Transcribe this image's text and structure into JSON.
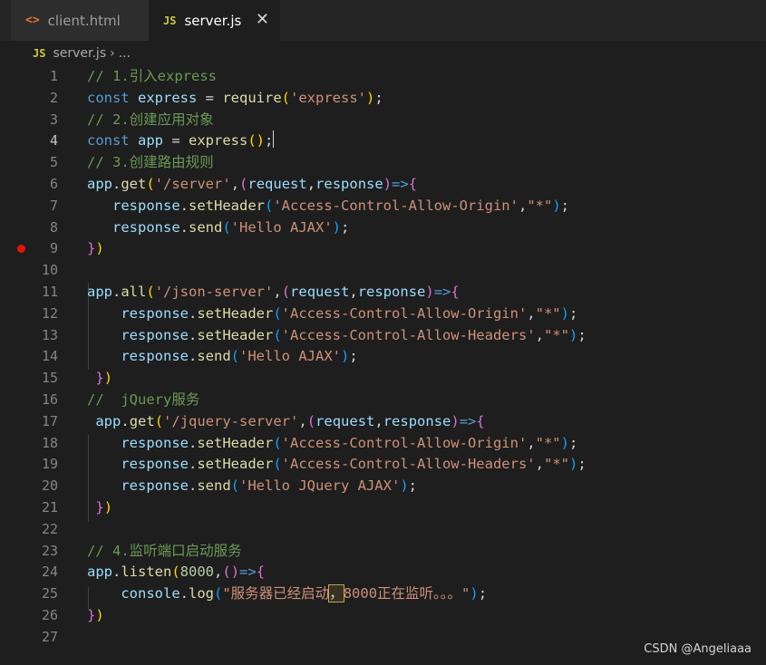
{
  "tabs": [
    {
      "icon": "<>",
      "label": "client.html"
    },
    {
      "icon": "JS",
      "label": "server.js",
      "close": "✕"
    }
  ],
  "breadcrumb": {
    "icon": "JS",
    "file": "server.js",
    "sep": "›",
    "rest": "..."
  },
  "lines": [
    {
      "n": "1",
      "t": [
        [
          "c",
          "// 1.引入express"
        ]
      ]
    },
    {
      "n": "2",
      "t": [
        [
          "k",
          "const"
        ],
        [
          "o",
          " "
        ],
        [
          "v",
          "express"
        ],
        [
          "o",
          " = "
        ],
        [
          "f",
          "require"
        ],
        [
          "p1",
          "("
        ],
        [
          "s",
          "'express'"
        ],
        [
          "p1",
          ")"
        ],
        [
          "o",
          ";"
        ]
      ]
    },
    {
      "n": "3",
      "t": [
        [
          "c",
          "// 2.创建应用对象"
        ]
      ]
    },
    {
      "n": "4",
      "t": [
        [
          "k",
          "const"
        ],
        [
          "o",
          " "
        ],
        [
          "v",
          "app"
        ],
        [
          "o",
          " = "
        ],
        [
          "f",
          "express"
        ],
        [
          "p1",
          "()"
        ],
        [
          "o",
          ";"
        ]
      ]
    },
    {
      "n": "5",
      "t": [
        [
          "c",
          "// 3.创建路由规则"
        ]
      ]
    },
    {
      "n": "6",
      "t": [
        [
          "v",
          "app"
        ],
        [
          "o",
          "."
        ],
        [
          "f",
          "get"
        ],
        [
          "p1",
          "("
        ],
        [
          "s",
          "'/server'"
        ],
        [
          "o",
          ","
        ],
        [
          "p2",
          "("
        ],
        [
          "v",
          "request"
        ],
        [
          "o",
          ","
        ],
        [
          "v",
          "response"
        ],
        [
          "p2",
          ")"
        ],
        [
          "k",
          "=>"
        ],
        [
          "p2",
          "{"
        ]
      ]
    },
    {
      "n": "7",
      "t": [
        [
          "o",
          "   "
        ],
        [
          "v",
          "response"
        ],
        [
          "o",
          "."
        ],
        [
          "f",
          "setHeader"
        ],
        [
          "p3",
          "("
        ],
        [
          "s",
          "'Access-Control-Allow-Origin'"
        ],
        [
          "o",
          ","
        ],
        [
          "s",
          "\"*\""
        ],
        [
          "p3",
          ")"
        ],
        [
          "o",
          ";"
        ]
      ]
    },
    {
      "n": "8",
      "t": [
        [
          "o",
          "   "
        ],
        [
          "v",
          "response"
        ],
        [
          "o",
          "."
        ],
        [
          "f",
          "send"
        ],
        [
          "p3",
          "("
        ],
        [
          "s",
          "'Hello AJAX'"
        ],
        [
          "p3",
          ")"
        ],
        [
          "o",
          ";"
        ]
      ]
    },
    {
      "n": "9",
      "t": [
        [
          "p2",
          "}"
        ],
        [
          "p1",
          ")"
        ]
      ]
    },
    {
      "n": "10",
      "t": []
    },
    {
      "n": "11",
      "t": [
        [
          "v",
          "app"
        ],
        [
          "o",
          "."
        ],
        [
          "f",
          "all"
        ],
        [
          "p1",
          "("
        ],
        [
          "s",
          "'/json-server'"
        ],
        [
          "o",
          ","
        ],
        [
          "p2",
          "("
        ],
        [
          "v",
          "request"
        ],
        [
          "o",
          ","
        ],
        [
          "v",
          "response"
        ],
        [
          "p2",
          ")"
        ],
        [
          "k",
          "=>"
        ],
        [
          "p2",
          "{"
        ]
      ]
    },
    {
      "n": "12",
      "t": [
        [
          "o",
          "    "
        ],
        [
          "v",
          "response"
        ],
        [
          "o",
          "."
        ],
        [
          "f",
          "setHeader"
        ],
        [
          "p3",
          "("
        ],
        [
          "s",
          "'Access-Control-Allow-Origin'"
        ],
        [
          "o",
          ","
        ],
        [
          "s",
          "\"*\""
        ],
        [
          "p3",
          ")"
        ],
        [
          "o",
          ";"
        ]
      ]
    },
    {
      "n": "13",
      "t": [
        [
          "o",
          "    "
        ],
        [
          "v",
          "response"
        ],
        [
          "o",
          "."
        ],
        [
          "f",
          "setHeader"
        ],
        [
          "p3",
          "("
        ],
        [
          "s",
          "'Access-Control-Allow-Headers'"
        ],
        [
          "o",
          ","
        ],
        [
          "s",
          "\"*\""
        ],
        [
          "p3",
          ")"
        ],
        [
          "o",
          ";"
        ]
      ]
    },
    {
      "n": "14",
      "t": [
        [
          "o",
          "    "
        ],
        [
          "v",
          "response"
        ],
        [
          "o",
          "."
        ],
        [
          "f",
          "send"
        ],
        [
          "p3",
          "("
        ],
        [
          "s",
          "'Hello AJAX'"
        ],
        [
          "p3",
          ")"
        ],
        [
          "o",
          ";"
        ]
      ]
    },
    {
      "n": "15",
      "t": [
        [
          "o",
          " "
        ],
        [
          "p2",
          "}"
        ],
        [
          "p1",
          ")"
        ]
      ]
    },
    {
      "n": "16",
      "t": [
        [
          "c",
          "//  jQuery服务"
        ]
      ]
    },
    {
      "n": "17",
      "t": [
        [
          "o",
          " "
        ],
        [
          "v",
          "app"
        ],
        [
          "o",
          "."
        ],
        [
          "f",
          "get"
        ],
        [
          "p1",
          "("
        ],
        [
          "s",
          "'/jquery-server'"
        ],
        [
          "o",
          ","
        ],
        [
          "p2",
          "("
        ],
        [
          "v",
          "request"
        ],
        [
          "o",
          ","
        ],
        [
          "v",
          "response"
        ],
        [
          "p2",
          ")"
        ],
        [
          "k",
          "=>"
        ],
        [
          "p2",
          "{"
        ]
      ]
    },
    {
      "n": "18",
      "t": [
        [
          "o",
          "    "
        ],
        [
          "v",
          "response"
        ],
        [
          "o",
          "."
        ],
        [
          "f",
          "setHeader"
        ],
        [
          "p3",
          "("
        ],
        [
          "s",
          "'Access-Control-Allow-Origin'"
        ],
        [
          "o",
          ","
        ],
        [
          "s",
          "\"*\""
        ],
        [
          "p3",
          ")"
        ],
        [
          "o",
          ";"
        ]
      ]
    },
    {
      "n": "19",
      "t": [
        [
          "o",
          "    "
        ],
        [
          "v",
          "response"
        ],
        [
          "o",
          "."
        ],
        [
          "f",
          "setHeader"
        ],
        [
          "p3",
          "("
        ],
        [
          "s",
          "'Access-Control-Allow-Headers'"
        ],
        [
          "o",
          ","
        ],
        [
          "s",
          "\"*\""
        ],
        [
          "p3",
          ")"
        ],
        [
          "o",
          ";"
        ]
      ]
    },
    {
      "n": "20",
      "t": [
        [
          "o",
          "    "
        ],
        [
          "v",
          "response"
        ],
        [
          "o",
          "."
        ],
        [
          "f",
          "send"
        ],
        [
          "p3",
          "("
        ],
        [
          "s",
          "'Hello JQuery AJAX'"
        ],
        [
          "p3",
          ")"
        ],
        [
          "o",
          ";"
        ]
      ]
    },
    {
      "n": "21",
      "t": [
        [
          "o",
          " "
        ],
        [
          "p2",
          "}"
        ],
        [
          "p1",
          ")"
        ]
      ]
    },
    {
      "n": "22",
      "t": []
    },
    {
      "n": "23",
      "t": [
        [
          "c",
          "// 4.监听端口启动服务"
        ]
      ]
    },
    {
      "n": "24",
      "t": [
        [
          "v",
          "app"
        ],
        [
          "o",
          "."
        ],
        [
          "f",
          "listen"
        ],
        [
          "p1",
          "("
        ],
        [
          "n",
          "8000"
        ],
        [
          "o",
          ","
        ],
        [
          "p2",
          "()"
        ],
        [
          "k",
          "=>"
        ],
        [
          "p2",
          "{"
        ]
      ]
    },
    {
      "n": "25",
      "t": [
        [
          "o",
          "    "
        ],
        [
          "v",
          "console"
        ],
        [
          "o",
          "."
        ],
        [
          "f",
          "log"
        ],
        [
          "p3",
          "("
        ],
        [
          "s",
          "\"服务器已经启动"
        ],
        [
          "hl",
          "，"
        ],
        [
          "s",
          "8000正在监听。。。\""
        ],
        [
          "p3",
          ")"
        ],
        [
          "o",
          ";"
        ]
      ]
    },
    {
      "n": "26",
      "t": [
        [
          "p2",
          "}"
        ],
        [
          "p1",
          ")"
        ]
      ]
    },
    {
      "n": "27",
      "t": []
    }
  ],
  "watermark": "CSDN @Angeliaaa"
}
